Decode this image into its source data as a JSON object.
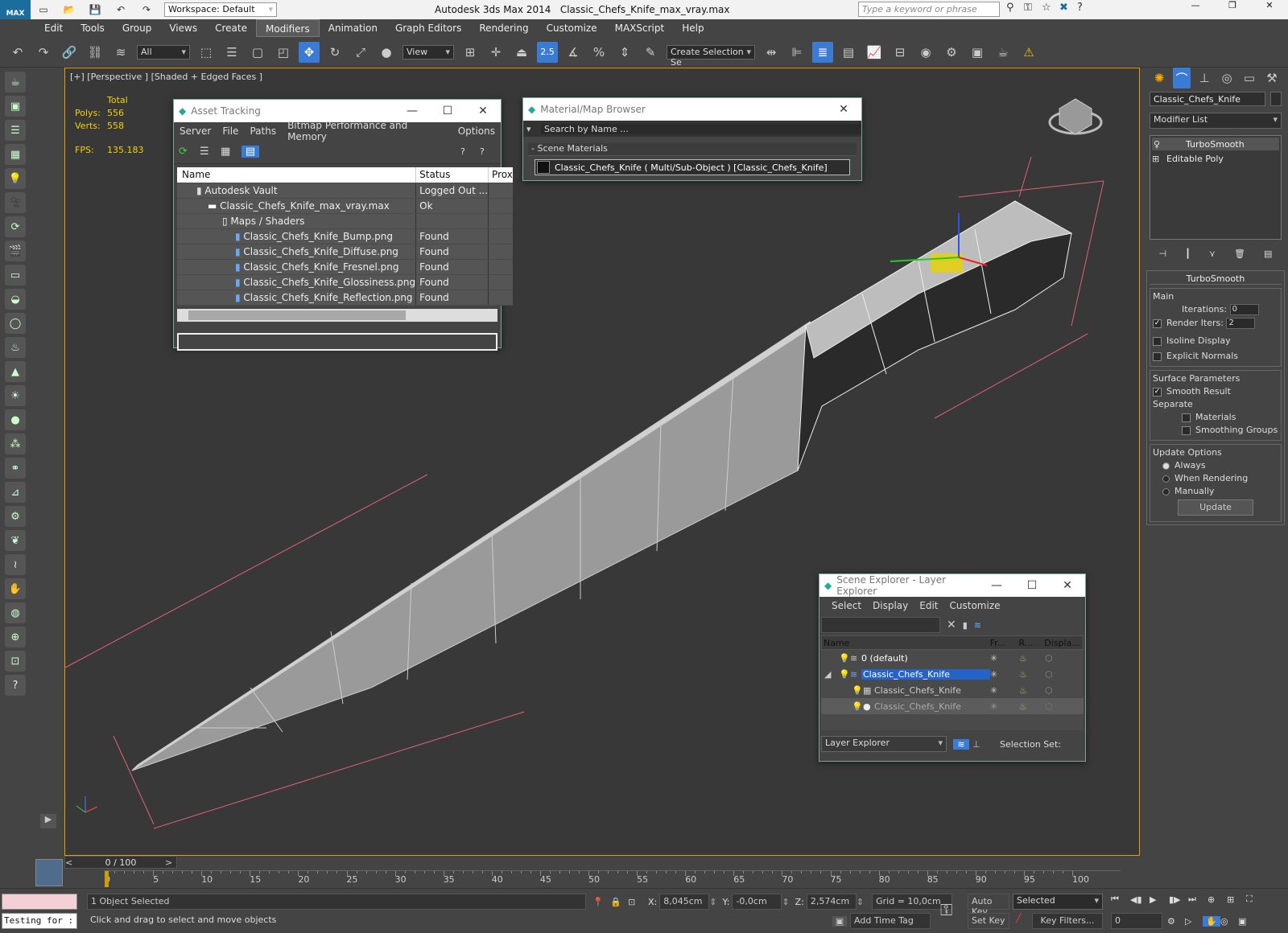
{
  "app": {
    "title": "Autodesk 3ds Max  2014",
    "file": "Classic_Chefs_Knife_max_vray.max",
    "logo": "MAX",
    "workspace": "Workspace: Default",
    "search_placeholder": "Type a keyword or phrase"
  },
  "menu": [
    "Edit",
    "Tools",
    "Group",
    "Views",
    "Create",
    "Modifiers",
    "Animation",
    "Graph Editors",
    "Rendering",
    "Customize",
    "MAXScript",
    "Help"
  ],
  "toolbar": {
    "filter": "All",
    "ref_coord": "View",
    "snap": "2.5",
    "selection_set": "Create Selection Se"
  },
  "viewport": {
    "label": "[+] [Perspective ] [Shaded + Edged Faces ]",
    "stats": {
      "total_label": "Total",
      "polys_label": "Polys:",
      "polys": "556",
      "verts_label": "Verts:",
      "verts": "558",
      "fps_label": "FPS:",
      "fps": "135.183"
    }
  },
  "asset_tracking": {
    "title": "Asset Tracking",
    "menu": [
      "Server",
      "File",
      "Paths",
      "Bitmap Performance and Memory",
      "Options"
    ],
    "columns": [
      "Name",
      "Status",
      "Prox"
    ],
    "rows": [
      {
        "name": "Autodesk Vault",
        "status": "Logged Out ..."
      },
      {
        "name": "Classic_Chefs_Knife_max_vray.max",
        "status": "Ok"
      },
      {
        "name": "Maps / Shaders",
        "status": ""
      },
      {
        "name": "Classic_Chefs_Knife_Bump.png",
        "status": "Found"
      },
      {
        "name": "Classic_Chefs_Knife_Diffuse.png",
        "status": "Found"
      },
      {
        "name": "Classic_Chefs_Knife_Fresnel.png",
        "status": "Found"
      },
      {
        "name": "Classic_Chefs_Knife_Glossiness.png",
        "status": "Found"
      },
      {
        "name": "Classic_Chefs_Knife_Reflection.png",
        "status": "Found"
      }
    ]
  },
  "material_browser": {
    "title": "Material/Map Browser",
    "search_placeholder": "Search by Name ...",
    "group": "- Scene Materials",
    "item": "Classic_Chefs_Knife  ( Multi/Sub-Object ) [Classic_Chefs_Knife]"
  },
  "scene_explorer": {
    "title": "Scene Explorer - Layer Explorer",
    "menu": [
      "Select",
      "Display",
      "Edit",
      "Customize"
    ],
    "columns": [
      "Name",
      "Fr...",
      "R...",
      "Displa..."
    ],
    "rows": [
      {
        "name": "0 (default)"
      },
      {
        "name": "Classic_Chefs_Knife"
      },
      {
        "name": "Classic_Chefs_Knife"
      },
      {
        "name": "Classic_Chefs_Knife"
      }
    ],
    "footer_combo": "Layer Explorer",
    "selection_set": "Selection Set:"
  },
  "command_panel": {
    "object_name": "Classic_Chefs_Knife",
    "modifier_list": "Modifier List",
    "stack": [
      "TurboSmooth",
      "Editable Poly"
    ],
    "turbosmooth": {
      "title": "TurboSmooth",
      "main": "Main",
      "iterations_label": "Iterations:",
      "iterations": "0",
      "render_iters_label": "Render Iters:",
      "render_iters": "2",
      "isoline": "Isoline Display",
      "explicit": "Explicit Normals",
      "surface": "Surface Parameters",
      "smooth_result": "Smooth Result",
      "separate": "Separate",
      "materials": "Materials",
      "smoothing_groups": "Smoothing Groups",
      "update_options": "Update Options",
      "always": "Always",
      "when_rendering": "When Rendering",
      "manually": "Manually",
      "update": "Update"
    }
  },
  "timeline": {
    "frame": "0 / 100",
    "ticks": [
      "0",
      "5",
      "10",
      "15",
      "20",
      "25",
      "30",
      "35",
      "40",
      "45",
      "50",
      "55",
      "60",
      "65",
      "70",
      "75",
      "80",
      "85",
      "90",
      "95",
      "100"
    ]
  },
  "status": {
    "script": "Testing for :",
    "selected": "1 Object Selected",
    "prompt": "Click and drag to select and move objects",
    "x_label": "X:",
    "x": "8,045cm",
    "y_label": "Y:",
    "y": "-0,0cm",
    "z_label": "Z:",
    "z": "2,574cm",
    "grid": "Grid = 10,0cm",
    "add_time_tag": "Add Time Tag",
    "auto_key": "Auto Key",
    "set_key": "Set Key",
    "key_mode": "Selected",
    "key_filters": "Key Filters...",
    "frame": "0"
  }
}
